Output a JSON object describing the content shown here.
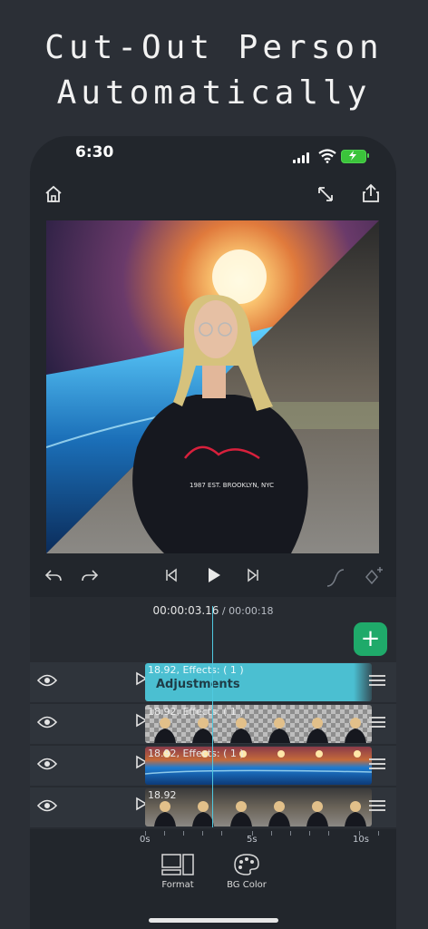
{
  "headline": {
    "line1": "Cut-Out Person",
    "line2": "Automatically"
  },
  "status_bar": {
    "time": "6:30"
  },
  "toolbar": {
    "home_icon": "home-icon",
    "resize_icon": "resize-icon",
    "share_icon": "share-icon"
  },
  "controls": {
    "undo": "undo-icon",
    "redo": "redo-icon",
    "prev": "skip-back-icon",
    "play": "play-icon",
    "next": "skip-forward-icon",
    "curve": "curve-icon",
    "keyframe": "keyframe-icon"
  },
  "timeline": {
    "current_time": "00:00:03.16",
    "separator": " / ",
    "total_time": "00:00:18",
    "tracks": [
      {
        "label": "18.92,  Effects: ( 1 )",
        "title": "Adjustments",
        "kind": "adjustments"
      },
      {
        "label": "18.92,  Effects: ( 1 )",
        "title": "",
        "kind": "cutout"
      },
      {
        "label": "18.92,  Effects: ( 1 )",
        "title": "",
        "kind": "space"
      },
      {
        "label": "18.92",
        "title": "",
        "kind": "video"
      }
    ],
    "ruler": [
      "0s",
      "5s",
      "10s"
    ]
  },
  "bottom_toolbar": {
    "format_label": "Format",
    "bg_color_label": "BG Color"
  },
  "colors": {
    "accent_add": "#1faa6a",
    "adjustments_clip": "#4bbfd1",
    "playhead": "#4fc9e0"
  }
}
